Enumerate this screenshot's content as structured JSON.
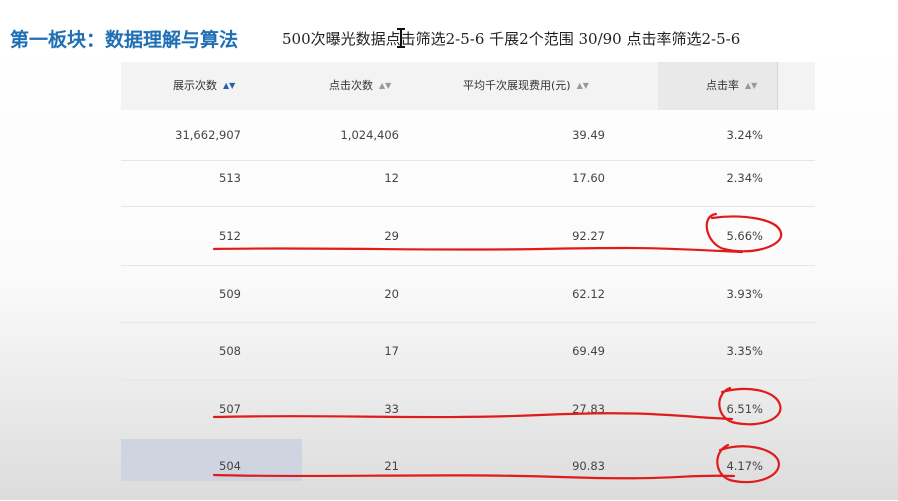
{
  "header": {
    "section_title": "第一板块：数据理解与算法",
    "note": "500次曝光数据点击筛选2-5-6  千展2个范围 30/90   点击率筛选2-5-6"
  },
  "table": {
    "columns": [
      {
        "label": "展示次数",
        "sort_icon": "sort-arrows-active-icon"
      },
      {
        "label": "点击次数",
        "sort_icon": "sort-arrows-icon"
      },
      {
        "label": "平均千次展现费用(元)",
        "sort_icon": "sort-arrows-icon"
      },
      {
        "label": "点击率",
        "sort_icon": "sort-arrows-icon"
      }
    ],
    "rows": [
      {
        "impressions": "31,662,907",
        "clicks": "1,024,406",
        "cpm": "39.49",
        "ctr": "3.24%"
      },
      {
        "impressions": "513",
        "clicks": "12",
        "cpm": "17.60",
        "ctr": "2.34%"
      },
      {
        "impressions": "512",
        "clicks": "29",
        "cpm": "92.27",
        "ctr": "5.66%"
      },
      {
        "impressions": "509",
        "clicks": "20",
        "cpm": "62.12",
        "ctr": "3.93%"
      },
      {
        "impressions": "508",
        "clicks": "17",
        "cpm": "69.49",
        "ctr": "3.35%"
      },
      {
        "impressions": "507",
        "clicks": "33",
        "cpm": "27.83",
        "ctr": "6.51%"
      },
      {
        "impressions": "504",
        "clicks": "21",
        "cpm": "90.83",
        "ctr": "4.17%"
      }
    ]
  },
  "colors": {
    "title_blue": "#1f6fb5",
    "annotation_red": "#e01b1b",
    "sort_active": "#2a5db0"
  }
}
